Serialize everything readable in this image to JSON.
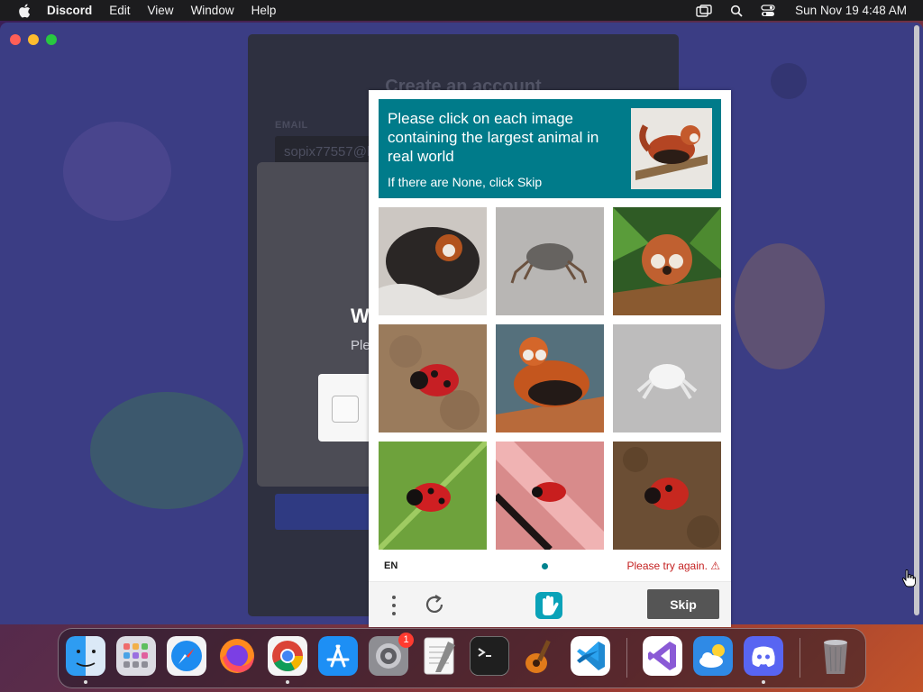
{
  "menubar": {
    "app_name": "Discord",
    "items": [
      "Edit",
      "View",
      "Window",
      "Help"
    ],
    "clock": "Sun Nov 19  4:48 AM"
  },
  "background_page": {
    "title": "Create an account",
    "email_label": "EMAIL",
    "email_value": "sopix77557@h",
    "modal_heading": "W",
    "modal_sub": "Ple"
  },
  "captcha": {
    "prompt": "Please click on each image containing the largest animal in real world",
    "hint": "If there are None, click Skip",
    "example_icon": "red-panda-image",
    "grid": [
      {
        "icon": "red-panda-dark-image"
      },
      {
        "icon": "crab-image"
      },
      {
        "icon": "red-panda-forest-image"
      },
      {
        "icon": "ladybug-soil-image"
      },
      {
        "icon": "red-panda-rock-image"
      },
      {
        "icon": "white-crab-image"
      },
      {
        "icon": "ladybug-leaf-image"
      },
      {
        "icon": "ladybug-pink-image"
      },
      {
        "icon": "ladybug-dirt-image"
      }
    ],
    "language": "EN",
    "error": "Please try again. ⚠",
    "skip_label": "Skip",
    "accent_color": "#007b8a"
  },
  "dock": {
    "apps": [
      {
        "name": "Finder",
        "icon": "finder-icon",
        "running": true
      },
      {
        "name": "Launchpad",
        "icon": "launchpad-icon",
        "running": false
      },
      {
        "name": "Safari",
        "icon": "safari-icon",
        "running": false
      },
      {
        "name": "Firefox",
        "icon": "firefox-icon",
        "running": false
      },
      {
        "name": "Chrome",
        "icon": "chrome-icon",
        "running": true
      },
      {
        "name": "App Store",
        "icon": "app-store-icon",
        "running": false
      },
      {
        "name": "System Settings",
        "icon": "system-settings-icon",
        "running": false,
        "badge": "1"
      },
      {
        "name": "TextEdit",
        "icon": "textedit-icon",
        "running": false
      },
      {
        "name": "Terminal",
        "icon": "terminal-icon",
        "running": false
      },
      {
        "name": "GarageBand",
        "icon": "garageband-icon",
        "running": false
      },
      {
        "name": "VS Code",
        "icon": "vscode-icon",
        "running": false
      },
      {
        "name": "Visual Studio",
        "icon": "visual-studio-icon",
        "running": false
      },
      {
        "name": "Weather",
        "icon": "weather-icon",
        "running": false
      },
      {
        "name": "Discord",
        "icon": "discord-icon",
        "running": true
      },
      {
        "name": "Trash",
        "icon": "trash-icon",
        "running": false
      }
    ]
  }
}
